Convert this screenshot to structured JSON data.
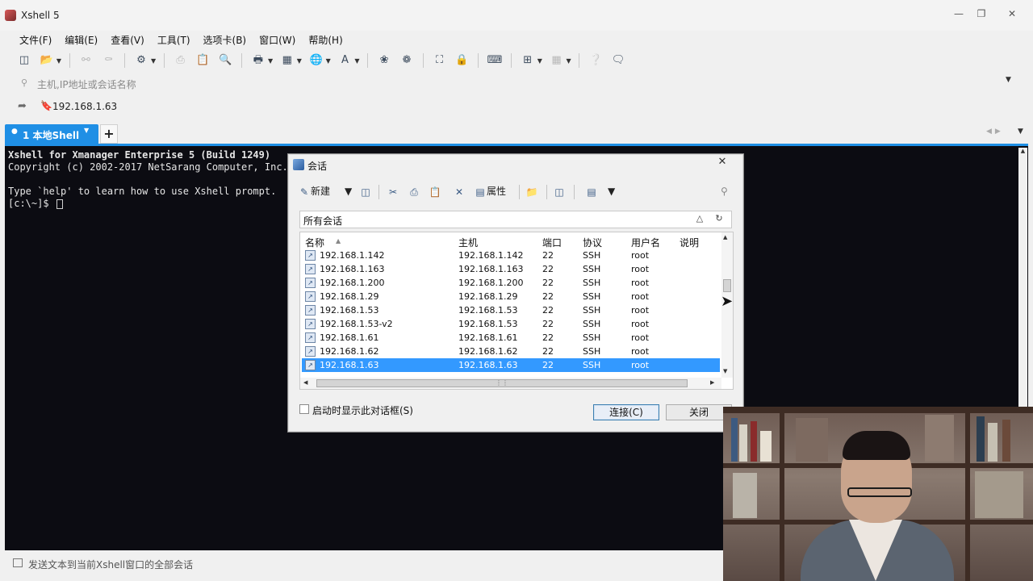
{
  "window": {
    "title": "Xshell 5",
    "controls": [
      "minimize",
      "restore",
      "close"
    ]
  },
  "menu": [
    "文件(F)",
    "编辑(E)",
    "查看(V)",
    "工具(T)",
    "选项卡(B)",
    "窗口(W)",
    "帮助(H)"
  ],
  "address": {
    "placeholder": "主机,IP地址或会话名称"
  },
  "links": {
    "bookmark": "192.168.1.63"
  },
  "tabs": {
    "active": "1 本地Shell",
    "add": "+"
  },
  "terminal": {
    "lines": [
      "Xshell for Xmanager Enterprise 5 (Build 1249)",
      "Copyright (c) 2002-2017 NetSarang Computer, Inc.",
      "",
      "Type `help' to learn how to use Xshell prompt.",
      "[c:\\~]$ "
    ]
  },
  "compose": {
    "label": "发送文本到当前Xshell窗口的全部会话"
  },
  "dialog": {
    "title": "会话",
    "toolbar": {
      "new_label": "新建",
      "properties_label": "属性"
    },
    "filter": "所有会话",
    "columns": {
      "name": "名称",
      "host": "主机",
      "port": "端口",
      "protocol": "协议",
      "username": "用户名",
      "description": "说明"
    },
    "rows": [
      {
        "name": "192.168.1.142",
        "host": "192.168.1.142",
        "port": "22",
        "protocol": "SSH",
        "user": "root"
      },
      {
        "name": "192.168.1.163",
        "host": "192.168.1.163",
        "port": "22",
        "protocol": "SSH",
        "user": "root"
      },
      {
        "name": "192.168.1.200",
        "host": "192.168.1.200",
        "port": "22",
        "protocol": "SSH",
        "user": "root"
      },
      {
        "name": "192.168.1.29",
        "host": "192.168.1.29",
        "port": "22",
        "protocol": "SSH",
        "user": "root"
      },
      {
        "name": "192.168.1.53",
        "host": "192.168.1.53",
        "port": "22",
        "protocol": "SSH",
        "user": "root"
      },
      {
        "name": "192.168.1.53-v2",
        "host": "192.168.1.53",
        "port": "22",
        "protocol": "SSH",
        "user": "root"
      },
      {
        "name": "192.168.1.61",
        "host": "192.168.1.61",
        "port": "22",
        "protocol": "SSH",
        "user": "root"
      },
      {
        "name": "192.168.1.62",
        "host": "192.168.1.62",
        "port": "22",
        "protocol": "SSH",
        "user": "root"
      },
      {
        "name": "192.168.1.63",
        "host": "192.168.1.63",
        "port": "22",
        "protocol": "SSH",
        "user": "root",
        "selected": true
      }
    ],
    "checkbox_label": "启动时显示此对话框(S)",
    "connect_label": "连接(C)",
    "close_label": "关闭"
  },
  "colors": {
    "accent": "#1f8fe5",
    "selection": "#3399ff",
    "terminal_bg": "#0c0c12"
  }
}
